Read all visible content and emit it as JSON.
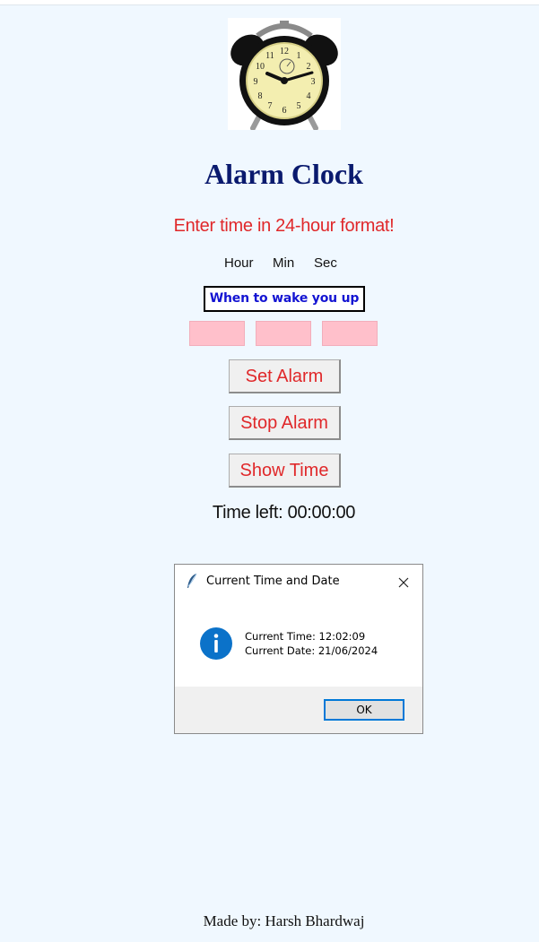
{
  "app": {
    "title": "Alarm Clock",
    "instruction": "Enter time in 24-hour format!",
    "labels": {
      "hour": "Hour",
      "min": "Min",
      "sec": "Sec"
    },
    "wake_label": "When to wake you up",
    "inputs": {
      "hour": "",
      "min": "",
      "sec": ""
    },
    "buttons": {
      "set": "Set Alarm",
      "stop": "Stop Alarm",
      "show": "Show Time"
    },
    "time_left": "Time left: 00:00:00",
    "footer": "Made by: Harsh Bhardwaj"
  },
  "dialog": {
    "title": "Current Time and Date",
    "line1": "Current Time: 12:02:09",
    "line2": "Current Date: 21/06/2024",
    "ok": "OK",
    "icon": "info-icon"
  },
  "colors": {
    "background": "#f0f8ff",
    "title": "#0a1a6e",
    "accent_red": "#e0282a",
    "input_pink": "#ffc0cb",
    "wake_blue": "#1414d2",
    "dialog_focus": "#0078d7"
  }
}
